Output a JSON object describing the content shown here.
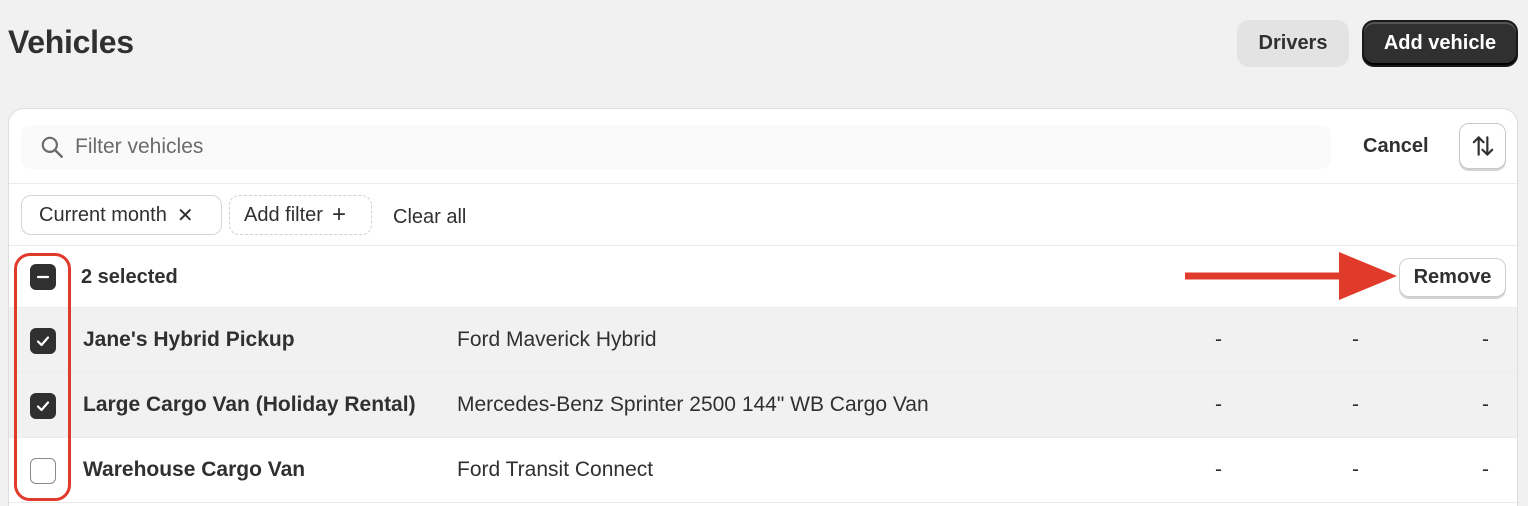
{
  "header": {
    "title": "Vehicles",
    "drivers_label": "Drivers",
    "add_vehicle_label": "Add vehicle"
  },
  "search": {
    "placeholder": "Filter vehicles",
    "cancel_label": "Cancel",
    "sort_icon": "sort-arrows-icon"
  },
  "filters": {
    "chips": [
      {
        "label": "Current month",
        "icon": "close-icon"
      }
    ],
    "add_filter_label": "Add filter",
    "clear_all_label": "Clear all"
  },
  "selection": {
    "state": "indeterminate",
    "count_label": "2 selected",
    "remove_label": "Remove"
  },
  "rows": [
    {
      "checked": true,
      "name": "Jane's Hybrid Pickup",
      "model": "Ford Maverick Hybrid",
      "col3": "-",
      "col4": "-",
      "col5": "-"
    },
    {
      "checked": true,
      "name": "Large Cargo Van (Holiday Rental)",
      "model": "Mercedes-Benz Sprinter 2500 144\" WB Cargo Van",
      "col3": "-",
      "col4": "-",
      "col5": "-"
    },
    {
      "checked": false,
      "name": "Warehouse Cargo Van",
      "model": "Ford Transit Connect",
      "col3": "-",
      "col4": "-",
      "col5": "-"
    }
  ],
  "annotation": {
    "color": "#e03a2a"
  },
  "colors": {
    "background": "#f1f1f1",
    "primary_button": "#303030",
    "text": "#303030"
  }
}
